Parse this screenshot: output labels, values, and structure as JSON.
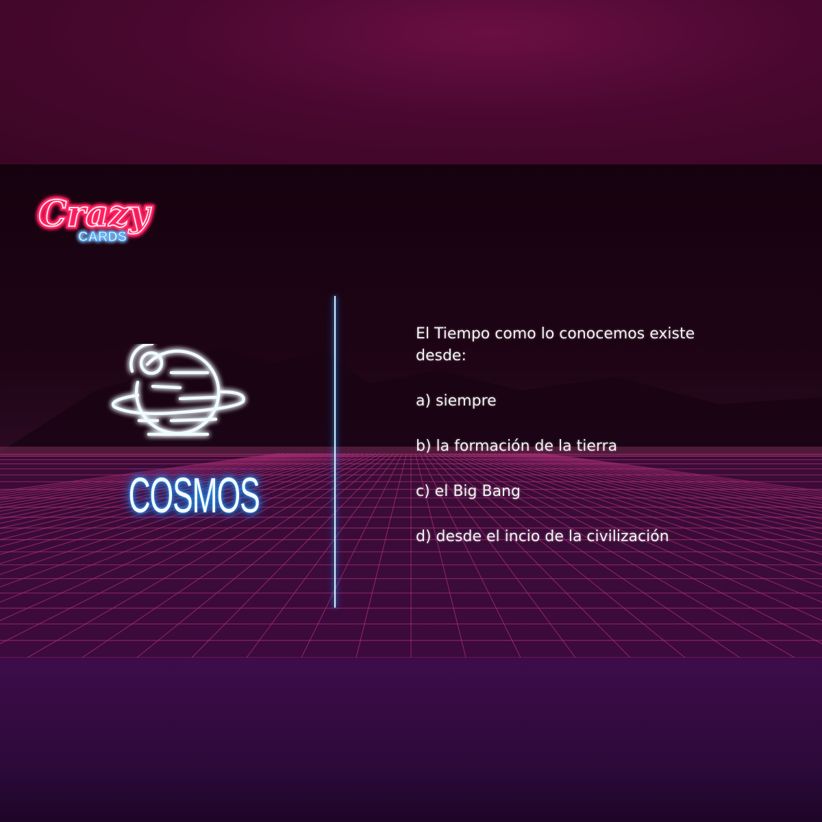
{
  "logo": {
    "brand": "Crazy",
    "subtitle": "CARDS"
  },
  "category": {
    "icon": "planet-icon",
    "label": "COSMOS"
  },
  "question": {
    "text": "El Tiempo como lo conocemos existe desde:",
    "answers": [
      "a) siempre",
      "b) la formación de la tierra",
      "c) el Big Bang",
      "d) desde el incio de la civilización"
    ]
  },
  "colors": {
    "neon_pink": "#ff1f5a",
    "neon_blue": "#2aa8ff",
    "grid": "#b0307a"
  }
}
